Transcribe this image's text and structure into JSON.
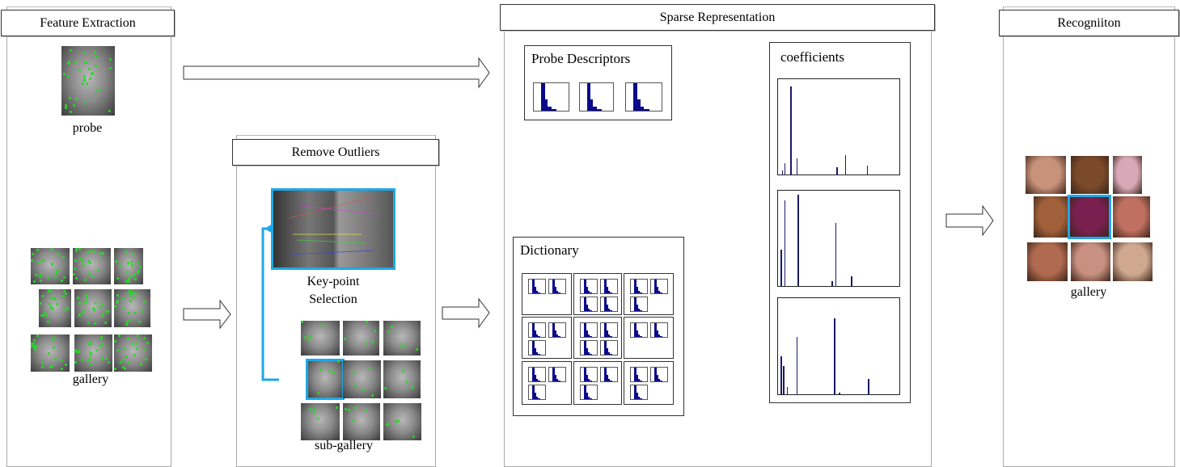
{
  "panels": {
    "feature_extraction": {
      "title": "Feature Extraction",
      "probe_label": "probe",
      "gallery_label": "gallery"
    },
    "remove_outliers": {
      "title": "Remove Outliers",
      "keypoint_label_line1": "Key-point",
      "keypoint_label_line2": "Selection",
      "subgallery_label": "sub-gallery"
    },
    "sparse_representation": {
      "title": "Sparse Representation",
      "probe_descriptors": "Probe Descriptors",
      "dictionary": "Dictionary",
      "coefficients": "coefficients",
      "dictionary_cell_histogram_counts": [
        2,
        4,
        3,
        3,
        4,
        2,
        3,
        3,
        3
      ]
    },
    "recognition": {
      "title": "Recogniiton",
      "gallery_label": "gallery"
    }
  },
  "colors": {
    "highlight": "#1ea7e8",
    "keypoints": "#22dd22",
    "histogram": "#0a0a8a"
  }
}
